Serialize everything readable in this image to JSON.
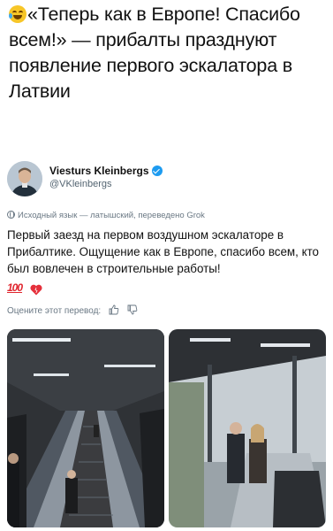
{
  "headline": {
    "emoji": "joy-emoji",
    "text": "«Теперь как в Европе! Спасибо всем!» — прибалты празднуют появление первого эскалатора в Латвии"
  },
  "tweet": {
    "author_name": "Viesturs Kleinbergs",
    "author_handle": "@VKleinbergs",
    "translated_note": "Исходный язык — латышский, переведено Grok",
    "text": "Первый заезд на первом воздушном эскалаторе в Прибалтике. Ощущение как в Европе, спасибо всем, кто был вовлечен в строительные работы!",
    "emoji_100": "100",
    "rate_label": "Оцените этот перевод:",
    "icons": [
      "globe-icon",
      "verified-icon",
      "thumbs-up-icon",
      "thumbs-down-icon",
      "heart-icon"
    ]
  },
  "media": [
    {
      "name": "escalator-photo-left"
    },
    {
      "name": "escalator-photo-right"
    }
  ],
  "colors": {
    "verified": "#1d9bf0",
    "muted_text": "#536471",
    "emoji_100": "#e0262f"
  }
}
